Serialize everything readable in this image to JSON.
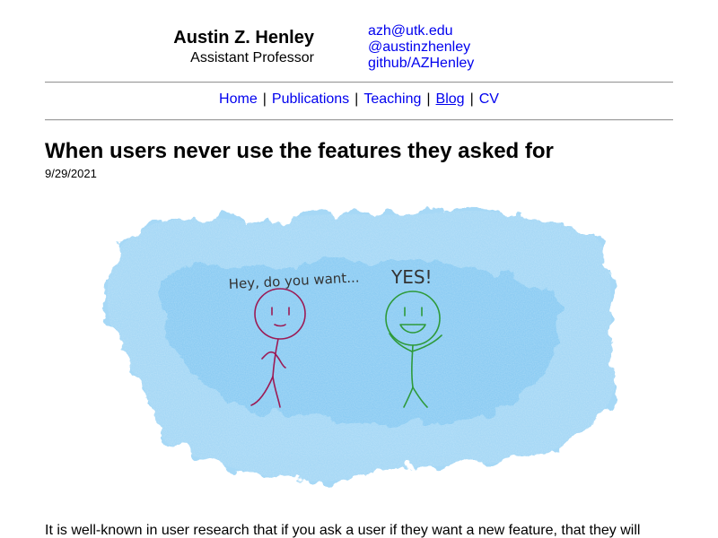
{
  "header": {
    "name": "Austin Z. Henley",
    "title": "Assistant Professor",
    "links": [
      {
        "label": "azh@utk.edu"
      },
      {
        "label": "@austinzhenley"
      },
      {
        "label": "github/AZHenley"
      }
    ]
  },
  "nav": {
    "items": [
      {
        "label": "Home"
      },
      {
        "label": "Publications"
      },
      {
        "label": "Teaching"
      },
      {
        "label": "Blog",
        "current": true
      },
      {
        "label": "CV"
      }
    ],
    "separator": "|"
  },
  "post": {
    "title": "When users never use the features they asked for",
    "date": "9/29/2021",
    "illustration": {
      "left_speech": "Hey, do you want...",
      "right_speech": "YES!",
      "background_color": "#5bb8ee",
      "left_figure_color": "#9c1b55",
      "right_figure_color": "#2e9a3a"
    },
    "lead_text": "It is well-known in user research that if you ask a user if they want a new feature, that they will"
  }
}
